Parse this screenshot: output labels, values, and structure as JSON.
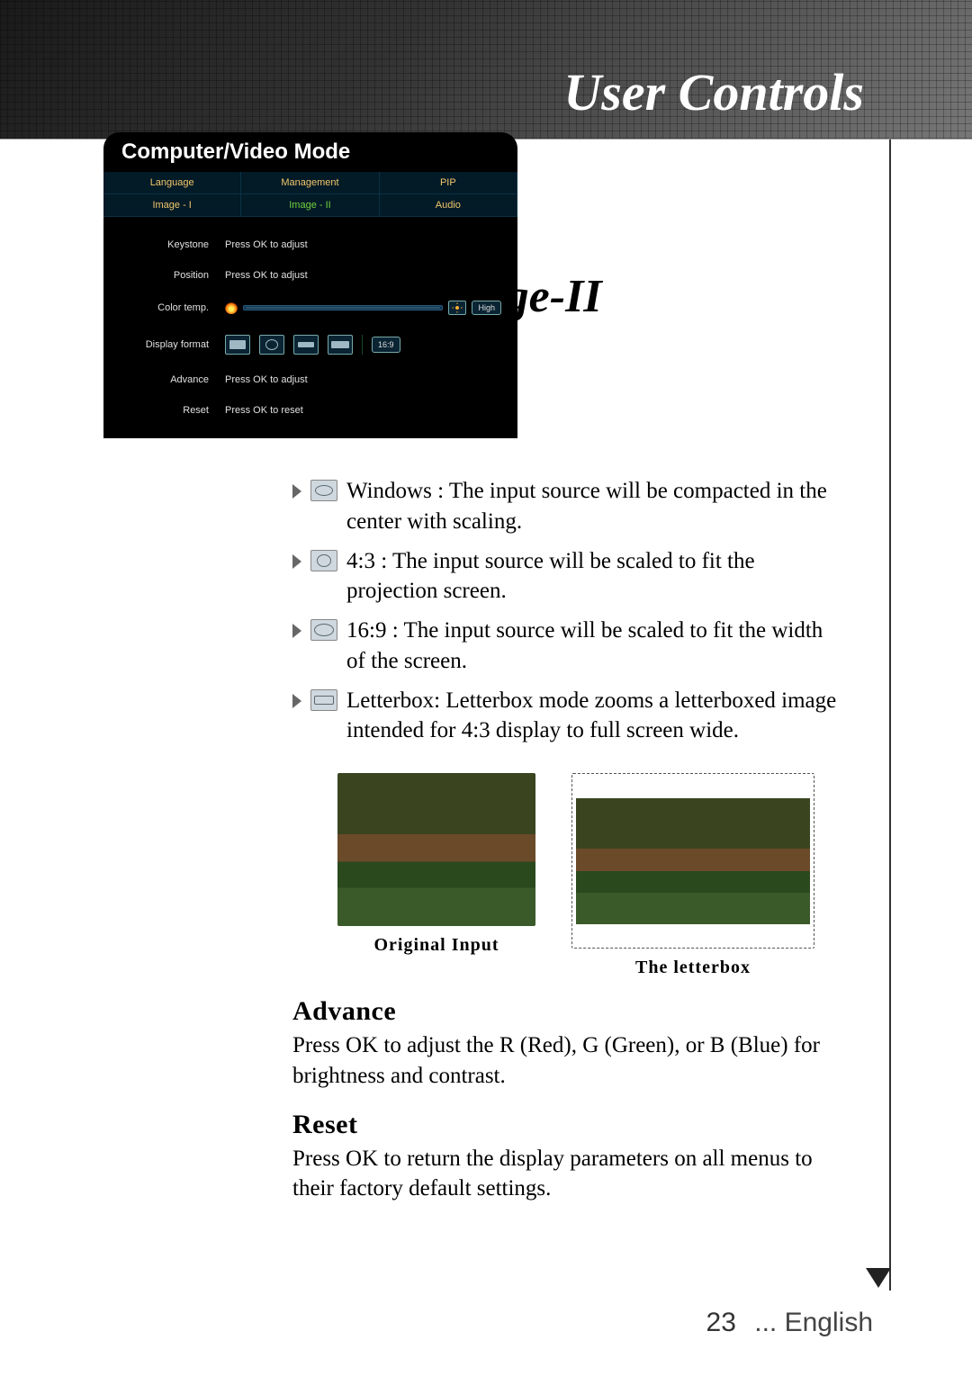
{
  "header": {
    "title": "User Controls"
  },
  "section": {
    "title": "Image-II"
  },
  "osd": {
    "title": "Computer/Video Mode",
    "tabs_row1": [
      "Language",
      "Management",
      "PIP"
    ],
    "tabs_row2": [
      "Image - I",
      "Image - II",
      "Audio"
    ],
    "selected_tab": "Image - II",
    "rows": {
      "keystone": {
        "label": "Keystone",
        "value": "Press OK to adjust"
      },
      "position": {
        "label": "Position",
        "value": "Press OK to adjust"
      },
      "colortemp": {
        "label": "Color temp.",
        "pill": "High"
      },
      "displayformat": {
        "label": "Display format",
        "pill": "16:9"
      },
      "advance": {
        "label": "Advance",
        "value": "Press OK to adjust"
      },
      "reset": {
        "label": "Reset",
        "value": "Press OK to reset"
      }
    }
  },
  "bullets": {
    "windows": "Windows : The input source will be compacted in the center with scaling.",
    "r43": "4:3 : The input source will be scaled to fit the projection screen.",
    "r169": "16:9 : The input source will be scaled to fit the width of the screen.",
    "lbx": "Letterbox: Letterbox mode zooms a letterboxed image intended for 4:3 display to full screen wide."
  },
  "image_captions": {
    "original": "Original Input",
    "letterbox": "The letterbox"
  },
  "advance": {
    "heading": "Advance",
    "text": "Press OK to adjust the R (Red), G (Green), or B (Blue) for brightness and contrast."
  },
  "reset": {
    "heading": "Reset",
    "text": "Press OK to return the display parameters on all menus to their factory default settings."
  },
  "footer": {
    "page": "23",
    "lang": "... English"
  }
}
